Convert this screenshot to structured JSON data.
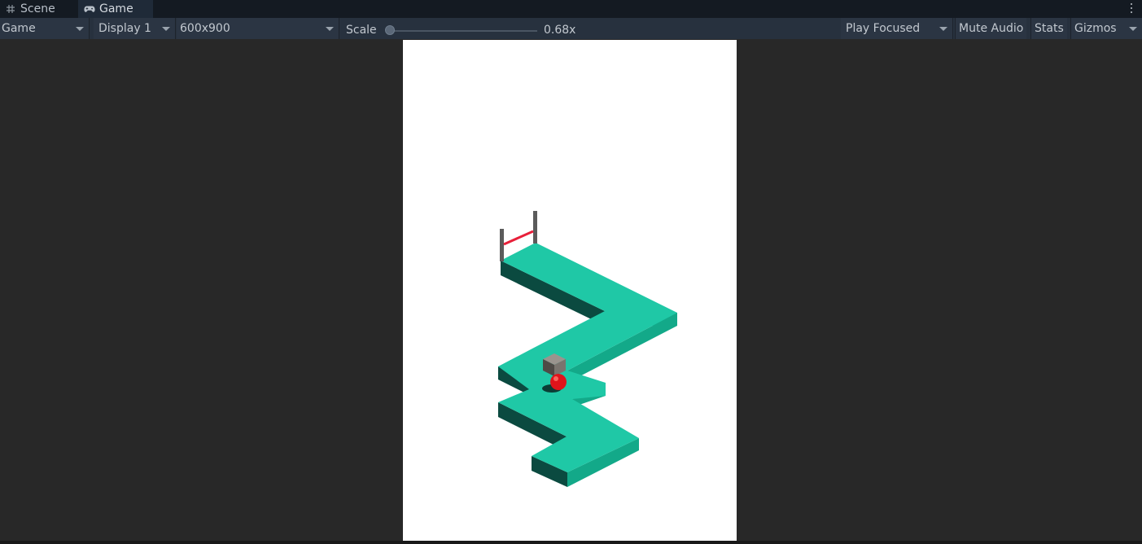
{
  "tabs": [
    {
      "label": "Scene",
      "icon": "grid-icon",
      "active": false
    },
    {
      "label": "Game",
      "icon": "gamepad-icon",
      "active": true
    }
  ],
  "toolbar": {
    "view_mode": "Game",
    "display": "Display 1",
    "resolution": "600x900",
    "scale_label": "Scale",
    "scale_value": "0.68x",
    "scale_fraction": 0.0,
    "play_mode": "Play Focused",
    "mute_audio": "Mute Audio",
    "stats": "Stats",
    "gizmos": "Gizmos"
  },
  "colors": {
    "editor_bg": "#282828",
    "tabbar_bg": "#141a22",
    "toolbar_bg": "#27313e",
    "viewport_bg": "#ffffff",
    "path_top": "#1fc8a6",
    "path_side_right": "#13a989",
    "path_side_left": "#0b4a40",
    "ball": "#e0141b",
    "cube": "#7a746e",
    "finish_line": "#e8203a"
  }
}
